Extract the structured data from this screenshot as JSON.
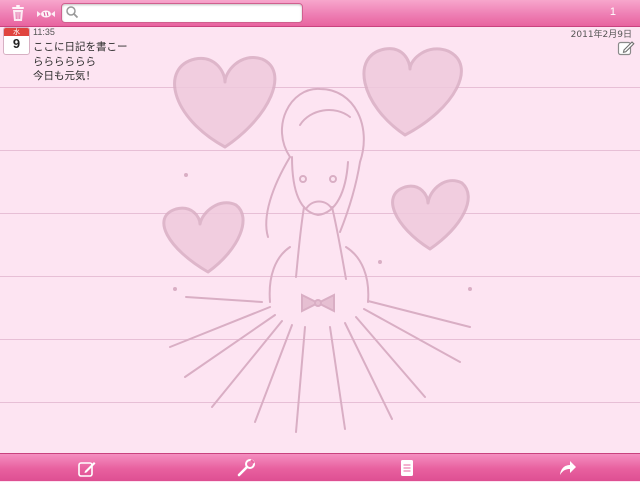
{
  "toolbar": {
    "search_placeholder": "",
    "page_number": "1",
    "icons": [
      "trash-icon",
      "candy-icon",
      "search-icon"
    ]
  },
  "entry": {
    "weekday": "水",
    "day": "9",
    "time": "11:35",
    "date": "2011年2月9日",
    "lines": [
      "ここに日記を書こー",
      "らららららら",
      "今日も元気！"
    ]
  },
  "bottombar": {
    "icons": [
      "compose-icon",
      "tools-icon",
      "memo-icon",
      "share-icon"
    ]
  },
  "colors": {
    "toolbar_pink": "#ee7fb4",
    "paper_pink": "#fde4f2",
    "rule_line": "#e7bfd6",
    "sketch_line": "#d9aec4"
  }
}
